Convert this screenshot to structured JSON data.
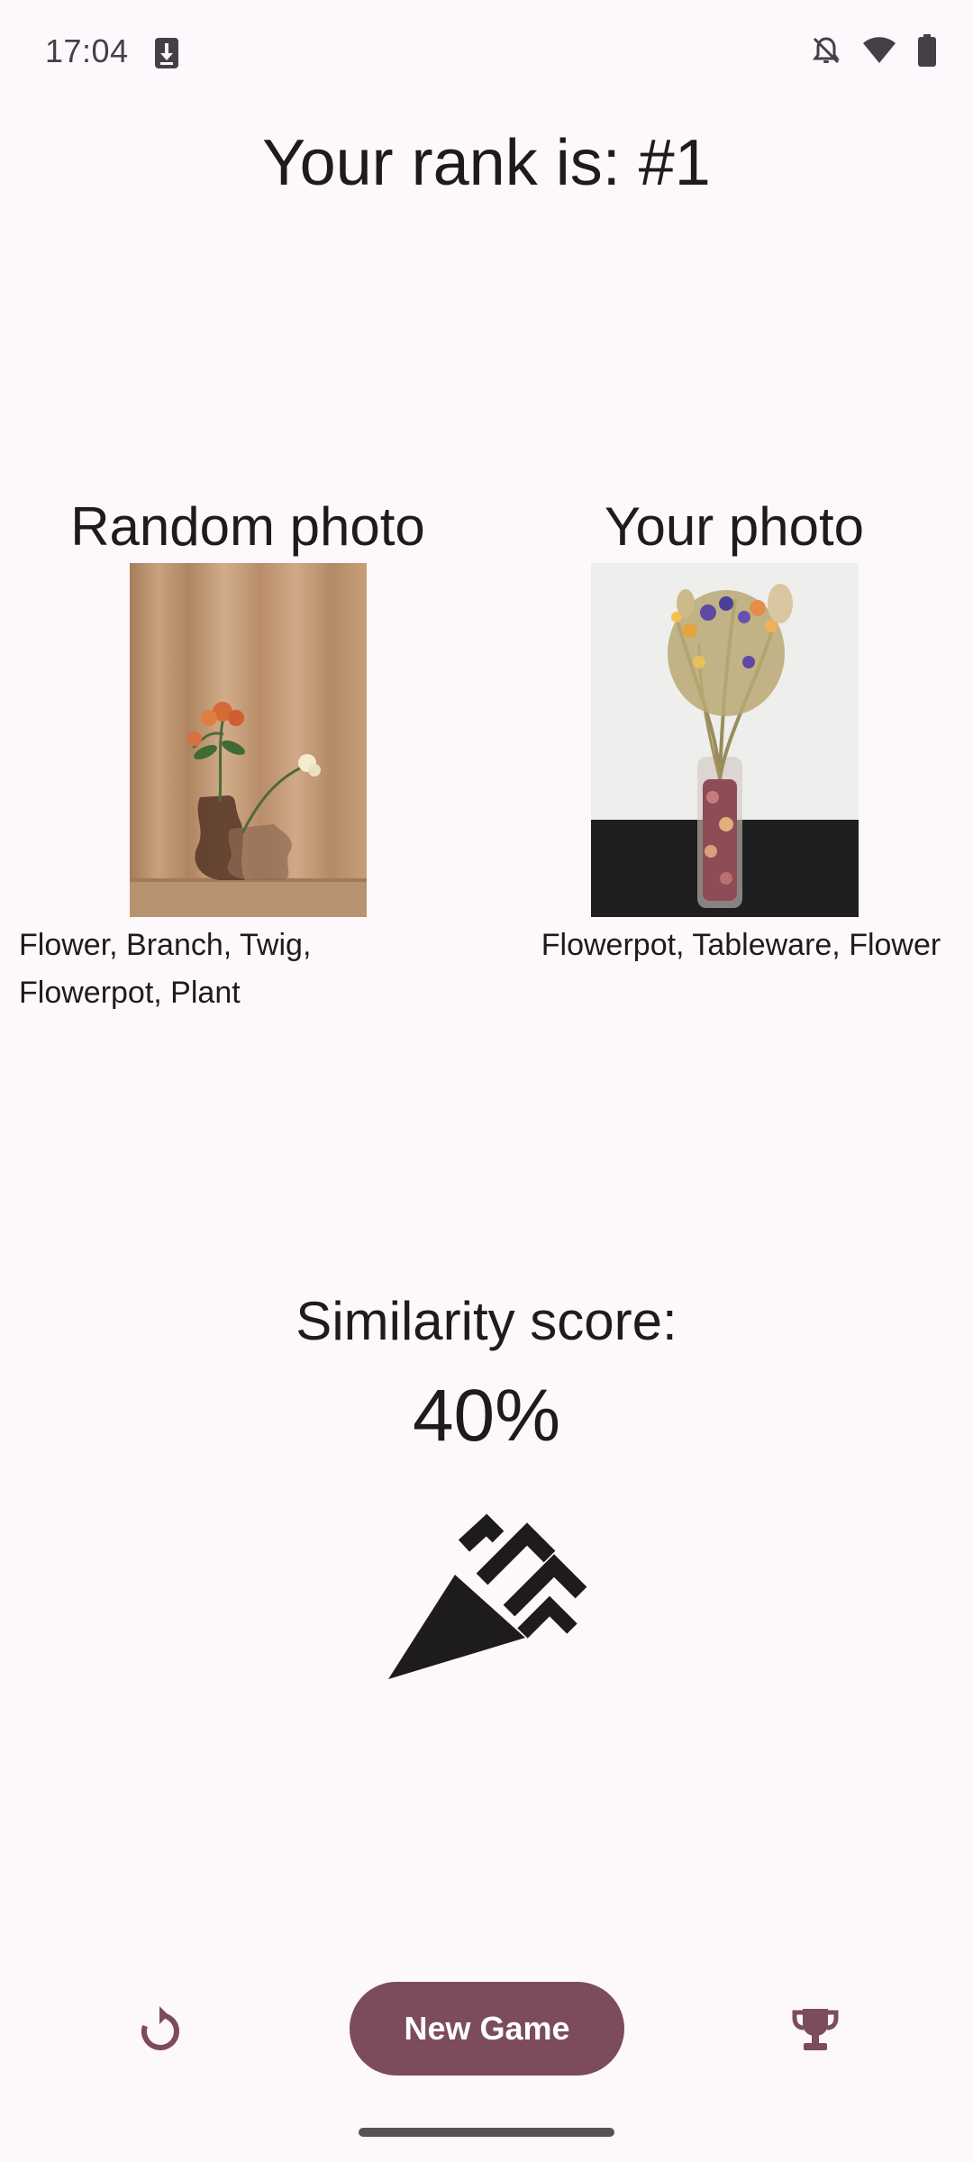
{
  "status_bar": {
    "time": "17:04",
    "icons": [
      "download-icon",
      "notifications-off-icon",
      "wifi-icon",
      "battery-icon"
    ]
  },
  "rank": {
    "title": "Your rank is: #1"
  },
  "random_photo": {
    "title": "Random photo",
    "image": "flowers-in-vases-curtain-photo",
    "labels": "Flower, Branch, Twig, Flowerpot, Plant"
  },
  "your_photo": {
    "title": "Your photo",
    "image": "dried-flowers-glass-vase-photo",
    "labels": "Flowerpot, Tableware, Flower"
  },
  "similarity": {
    "title": "Similarity score:",
    "value": "40%",
    "icon": "celebration-icon"
  },
  "bottom_bar": {
    "restart_icon": "restart-icon",
    "new_game_label": "New Game",
    "trophy_icon": "trophy-icon"
  },
  "colors": {
    "background": "#fdf8fb",
    "primary": "#7c4b5c",
    "on_primary": "#ffffff",
    "text": "#1d1b1e"
  }
}
